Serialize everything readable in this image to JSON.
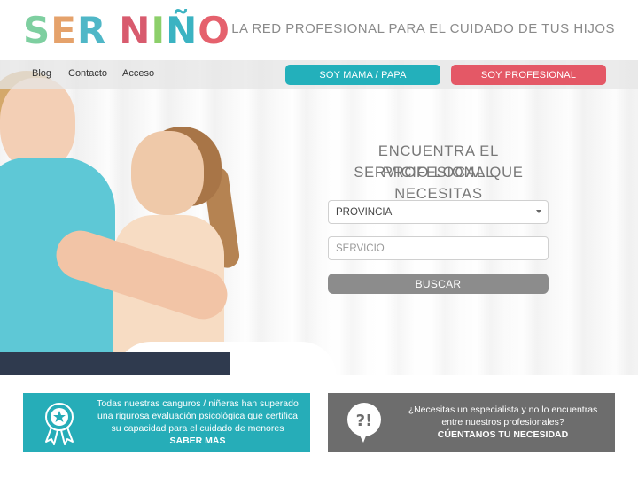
{
  "logo": {
    "letters": [
      "S",
      "E",
      "R",
      " ",
      "N",
      "I",
      "Ñ",
      "O"
    ],
    "colors": [
      "#7ecfa0",
      "#e5a26b",
      "#4fb7c7",
      "#ffffff",
      "#d85b6e",
      "#8ccf6a",
      "#3bb3c2",
      "#e5616d"
    ]
  },
  "header": {
    "tagline": "LA RED PROFESIONAL PARA EL CUIDADO DE TUS HIJOS"
  },
  "nav": {
    "links": [
      "Blog",
      "Contacto",
      "Acceso"
    ],
    "btn_parents": "SOY MAMA / PAPA",
    "btn_pro": "SOY PROFESIONAL"
  },
  "hero": {
    "title_line1": "ENCUENTRA EL PROFESIONAL",
    "title_line2": "SERVICIO LOCAL QUE NECESITAS",
    "province_value": "PROVINCIA",
    "service_placeholder": "SERVICIO",
    "search_button": "BUSCAR"
  },
  "boxes": {
    "left": {
      "line1": "Todas nuestras canguros / niñeras han superado",
      "line2": "una rigurosa evaluación psicológica que certifica",
      "line3": "su capacidad para el cuidado de menores",
      "cta": "SABER MÁS"
    },
    "right": {
      "line1": "¿Necesitas un especialista y no lo encuentras",
      "line2": "entre nuestros profesionales?",
      "cta": "CÚENTANOS TU NECESIDAD",
      "icon_text": "?!"
    }
  },
  "colors": {
    "teal": "#23b0bb",
    "coral": "#e45866",
    "gray": "#6d6d6d"
  }
}
